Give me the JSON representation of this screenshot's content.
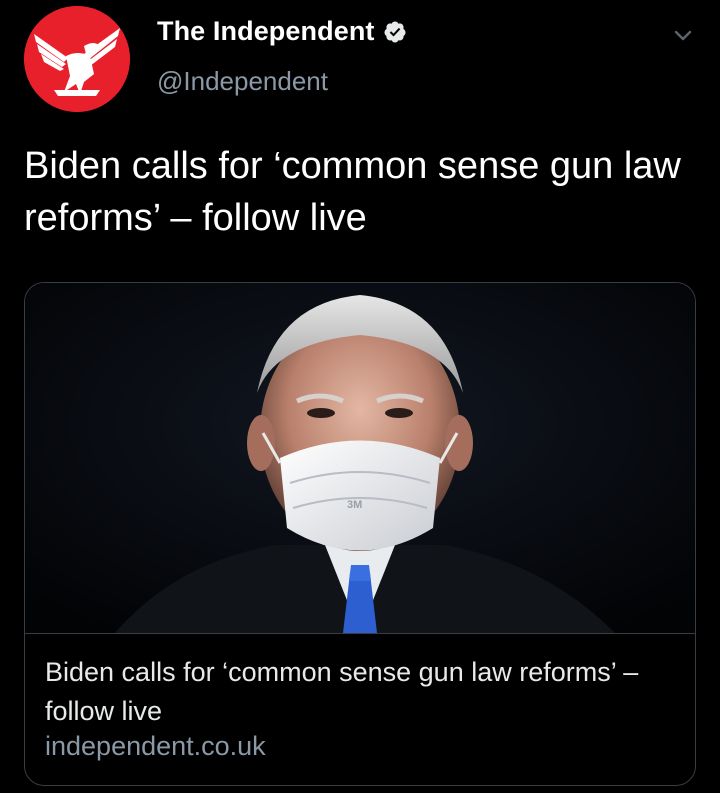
{
  "tweet": {
    "author": {
      "display_name": "The Independent",
      "handle": "@Independent",
      "verified": true,
      "avatar_color": "#e8202b",
      "avatar_icon": "eagle-logo"
    },
    "text": "Biden calls for ‘common sense gun law reforms’ – follow live",
    "menu_icon": "chevron-down-icon"
  },
  "link_card": {
    "image_description_icon": "photo",
    "title": "Biden calls for ‘common sense gun law reforms’ – follow live",
    "domain": "independent.co.uk"
  },
  "colors": {
    "background": "#000000",
    "primary_text": "#ffffff",
    "secondary_text": "#8b98a5",
    "border": "#3a3d42",
    "brand_red": "#e8202b"
  }
}
